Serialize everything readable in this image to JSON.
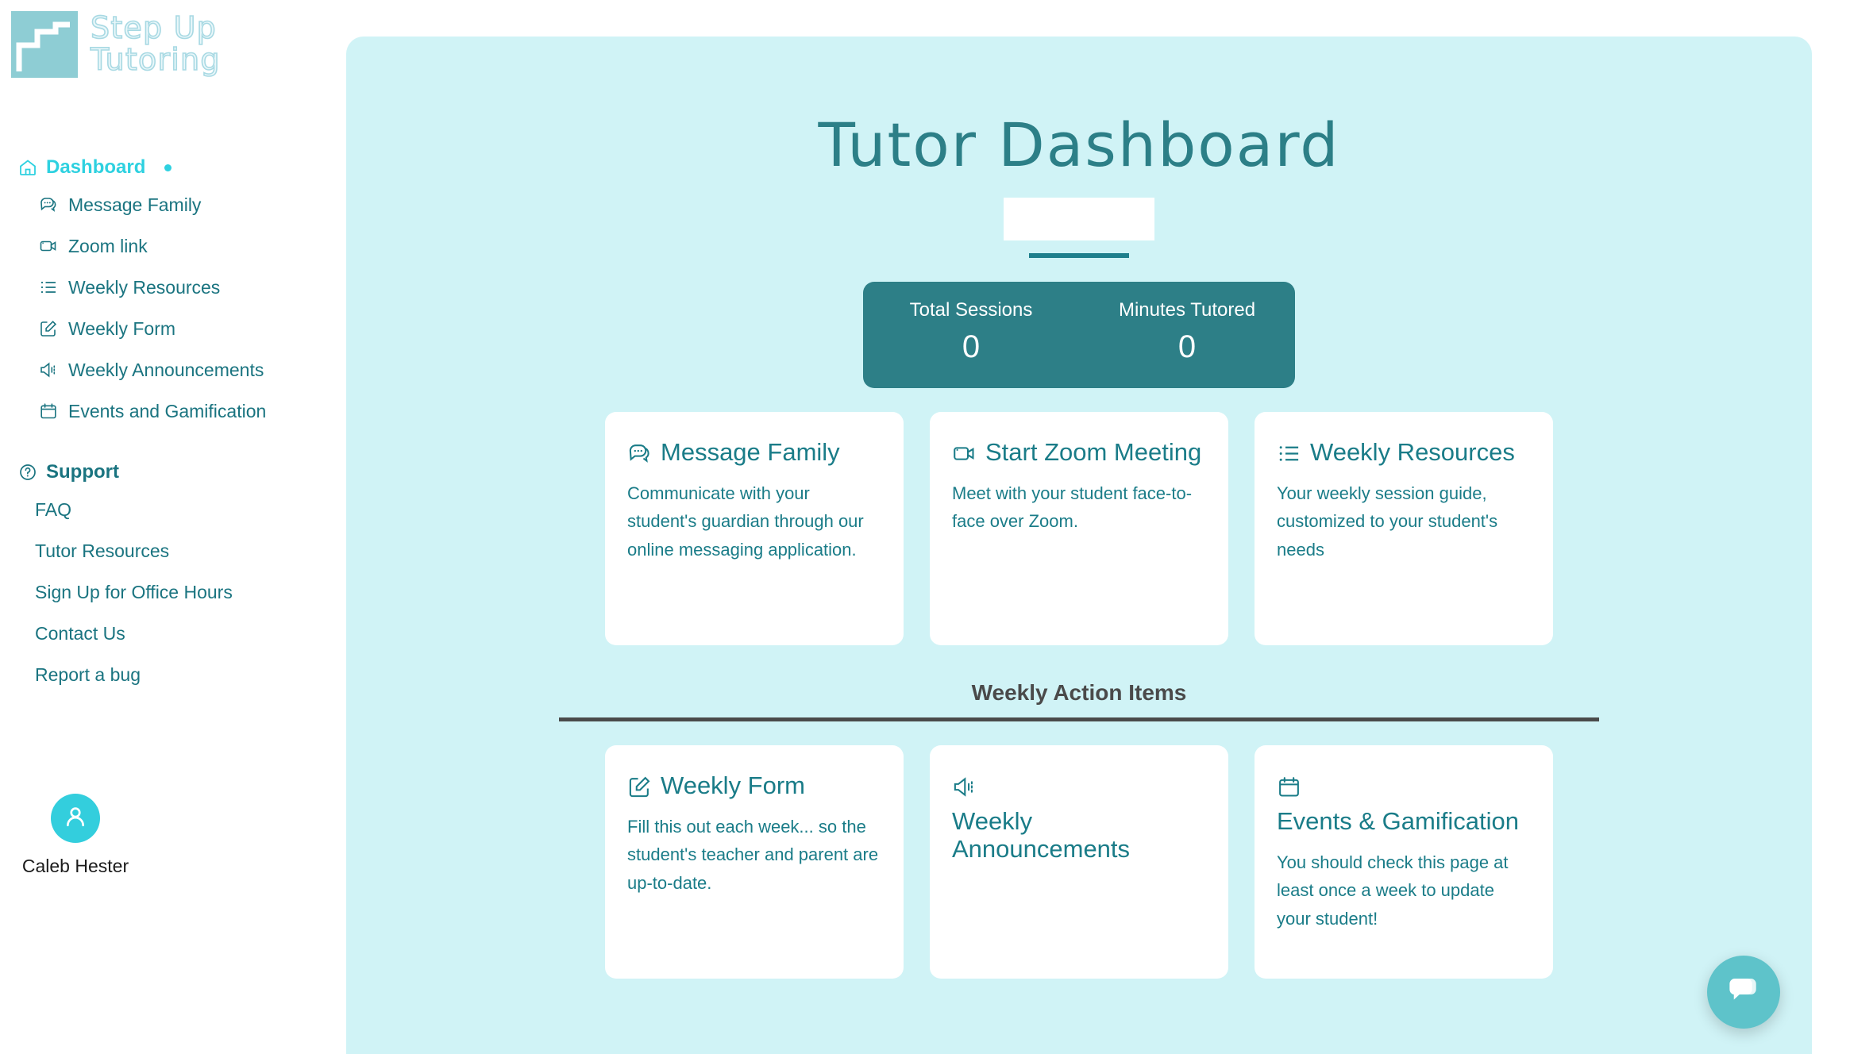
{
  "brand": {
    "line1": "Step Up",
    "line2": "Tutoring",
    "logo_icon": "staircase-icon"
  },
  "sidebar": {
    "dashboard_group": {
      "label": "Dashboard",
      "icon": "home-icon",
      "active_dot": true,
      "items": [
        {
          "label": "Message Family",
          "icon": "chat-bubble-icon"
        },
        {
          "label": "Zoom link",
          "icon": "video-camera-icon"
        },
        {
          "label": "Weekly Resources",
          "icon": "list-icon"
        },
        {
          "label": "Weekly Form",
          "icon": "edit-square-icon"
        },
        {
          "label": "Weekly Announcements",
          "icon": "megaphone-icon"
        },
        {
          "label": "Events and Gamification",
          "icon": "calendar-icon"
        }
      ]
    },
    "support_group": {
      "label": "Support",
      "icon": "question-circle-icon",
      "items": [
        {
          "label": "FAQ"
        },
        {
          "label": "Tutor Resources"
        },
        {
          "label": "Sign Up for Office Hours"
        },
        {
          "label": "Contact Us"
        },
        {
          "label": "Report a bug"
        }
      ]
    },
    "profile": {
      "name": "Caleb Hester",
      "avatar_icon": "user-icon"
    }
  },
  "main": {
    "page_title": "Tutor Dashboard",
    "title_field_value": "",
    "stats": [
      {
        "label": "Total Sessions",
        "value": "0"
      },
      {
        "label": "Minutes Tutored",
        "value": "0"
      }
    ],
    "top_cards": [
      {
        "title": "Message Family",
        "icon": "chat-bubble-icon",
        "body": "Communicate with your student's guardian through our online messaging application."
      },
      {
        "title": "Start Zoom Meeting",
        "icon": "video-camera-icon",
        "body": "Meet with your student face-to-face over Zoom."
      },
      {
        "title": "Weekly Resources",
        "icon": "list-icon",
        "body": "Your weekly session guide, customized to your student's needs"
      }
    ],
    "section_heading": "Weekly Action Items",
    "action_cards": [
      {
        "title": "Weekly Form",
        "icon": "edit-square-icon",
        "body": "Fill this out each week... so the student's teacher and parent are up-to-date."
      },
      {
        "title": "Weekly Announcements",
        "icon": "megaphone-icon",
        "body": ""
      },
      {
        "title": "Events & Gamification",
        "icon": "calendar-icon",
        "body": "You should check this page at least once a week to update your student!"
      }
    ],
    "chat_fab_icon": "chat-bubbles-icon"
  },
  "colors": {
    "panel_bg": "#D0F3F6",
    "teal_dark": "#1A7C88",
    "teal_stats": "#2D7F87",
    "cyan_accent": "#2ED1E0",
    "logo_square": "#8ECDD4",
    "gray_heading": "#4A4A4A",
    "fab": "#5EC3CA"
  }
}
